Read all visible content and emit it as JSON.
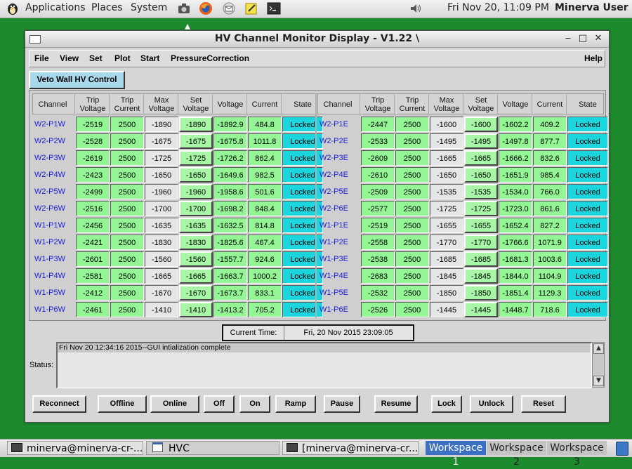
{
  "top_panel": {
    "applications": "Applications",
    "places": "Places",
    "system": "System",
    "clock": "Fri Nov 20, 11:09 PM",
    "user": "Minerva User"
  },
  "window": {
    "title": "HV Channel Monitor Display - V1.22 \\",
    "menus": [
      "File",
      "View",
      "Set",
      "Plot",
      "Start",
      "PressureCorrection"
    ],
    "help": "Help"
  },
  "tab_label": "Veto Wall HV Control",
  "headers": {
    "channel": "Channel",
    "trip_voltage": "Trip Voltage",
    "trip_current": "Trip Current",
    "max_voltage": "Max Voltage",
    "set_voltage": "Set Voltage",
    "voltage": "Voltage",
    "current": "Current",
    "state": "State"
  },
  "left_rows": [
    {
      "channel": "W2-P1W",
      "trip_voltage": "-2519",
      "trip_current": "2500",
      "max_voltage": "-1890",
      "set_voltage": "-1890",
      "voltage": "-1892.9",
      "current": "484.8",
      "state": "Locked"
    },
    {
      "channel": "W2-P2W",
      "trip_voltage": "-2528",
      "trip_current": "2500",
      "max_voltage": "-1675",
      "set_voltage": "-1675",
      "voltage": "-1675.8",
      "current": "1011.8",
      "state": "Locked"
    },
    {
      "channel": "W2-P3W",
      "trip_voltage": "-2619",
      "trip_current": "2500",
      "max_voltage": "-1725",
      "set_voltage": "-1725",
      "voltage": "-1726.2",
      "current": "862.4",
      "state": "Locked"
    },
    {
      "channel": "W2-P4W",
      "trip_voltage": "-2423",
      "trip_current": "2500",
      "max_voltage": "-1650",
      "set_voltage": "-1650",
      "voltage": "-1649.6",
      "current": "982.5",
      "state": "Locked"
    },
    {
      "channel": "W2-P5W",
      "trip_voltage": "-2499",
      "trip_current": "2500",
      "max_voltage": "-1960",
      "set_voltage": "-1960",
      "voltage": "-1958.6",
      "current": "501.6",
      "state": "Locked"
    },
    {
      "channel": "W2-P6W",
      "trip_voltage": "-2516",
      "trip_current": "2500",
      "max_voltage": "-1700",
      "set_voltage": "-1700",
      "voltage": "-1698.2",
      "current": "848.4",
      "state": "Locked"
    },
    {
      "channel": "W1-P1W",
      "trip_voltage": "-2456",
      "trip_current": "2500",
      "max_voltage": "-1635",
      "set_voltage": "-1635",
      "voltage": "-1632.5",
      "current": "814.8",
      "state": "Locked"
    },
    {
      "channel": "W1-P2W",
      "trip_voltage": "-2421",
      "trip_current": "2500",
      "max_voltage": "-1830",
      "set_voltage": "-1830",
      "voltage": "-1825.6",
      "current": "467.4",
      "state": "Locked"
    },
    {
      "channel": "W1-P3W",
      "trip_voltage": "-2601",
      "trip_current": "2500",
      "max_voltage": "-1560",
      "set_voltage": "-1560",
      "voltage": "-1557.7",
      "current": "924.6",
      "state": "Locked"
    },
    {
      "channel": "W1-P4W",
      "trip_voltage": "-2581",
      "trip_current": "2500",
      "max_voltage": "-1665",
      "set_voltage": "-1665",
      "voltage": "-1663.7",
      "current": "1000.2",
      "state": "Locked"
    },
    {
      "channel": "W1-P5W",
      "trip_voltage": "-2412",
      "trip_current": "2500",
      "max_voltage": "-1670",
      "set_voltage": "-1670",
      "voltage": "-1673.7",
      "current": "833.1",
      "state": "Locked"
    },
    {
      "channel": "W1-P6W",
      "trip_voltage": "-2461",
      "trip_current": "2500",
      "max_voltage": "-1410",
      "set_voltage": "-1410",
      "voltage": "-1413.2",
      "current": "705.2",
      "state": "Locked"
    }
  ],
  "right_rows": [
    {
      "channel": "W2-P1E",
      "trip_voltage": "-2447",
      "trip_current": "2500",
      "max_voltage": "-1600",
      "set_voltage": "-1600",
      "voltage": "-1602.2",
      "current": "409.2",
      "state": "Locked"
    },
    {
      "channel": "W2-P2E",
      "trip_voltage": "-2533",
      "trip_current": "2500",
      "max_voltage": "-1495",
      "set_voltage": "-1495",
      "voltage": "-1497.8",
      "current": "877.7",
      "state": "Locked"
    },
    {
      "channel": "W2-P3E",
      "trip_voltage": "-2609",
      "trip_current": "2500",
      "max_voltage": "-1665",
      "set_voltage": "-1665",
      "voltage": "-1666.2",
      "current": "832.6",
      "state": "Locked"
    },
    {
      "channel": "W2-P4E",
      "trip_voltage": "-2610",
      "trip_current": "2500",
      "max_voltage": "-1650",
      "set_voltage": "-1650",
      "voltage": "-1651.9",
      "current": "985.4",
      "state": "Locked"
    },
    {
      "channel": "W2-P5E",
      "trip_voltage": "-2509",
      "trip_current": "2500",
      "max_voltage": "-1535",
      "set_voltage": "-1535",
      "voltage": "-1534.0",
      "current": "766.0",
      "state": "Locked"
    },
    {
      "channel": "W2-P6E",
      "trip_voltage": "-2577",
      "trip_current": "2500",
      "max_voltage": "-1725",
      "set_voltage": "-1725",
      "voltage": "-1723.0",
      "current": "861.6",
      "state": "Locked"
    },
    {
      "channel": "W1-P1E",
      "trip_voltage": "-2519",
      "trip_current": "2500",
      "max_voltage": "-1655",
      "set_voltage": "-1655",
      "voltage": "-1652.4",
      "current": "827.2",
      "state": "Locked"
    },
    {
      "channel": "W1-P2E",
      "trip_voltage": "-2558",
      "trip_current": "2500",
      "max_voltage": "-1770",
      "set_voltage": "-1770",
      "voltage": "-1766.6",
      "current": "1071.9",
      "state": "Locked"
    },
    {
      "channel": "W1-P3E",
      "trip_voltage": "-2538",
      "trip_current": "2500",
      "max_voltage": "-1685",
      "set_voltage": "-1685",
      "voltage": "-1681.3",
      "current": "1003.6",
      "state": "Locked"
    },
    {
      "channel": "W1-P4E",
      "trip_voltage": "-2683",
      "trip_current": "2500",
      "max_voltage": "-1845",
      "set_voltage": "-1845",
      "voltage": "-1844.0",
      "current": "1104.9",
      "state": "Locked"
    },
    {
      "channel": "W1-P5E",
      "trip_voltage": "-2532",
      "trip_current": "2500",
      "max_voltage": "-1850",
      "set_voltage": "-1850",
      "voltage": "-1851.4",
      "current": "1129.3",
      "state": "Locked"
    },
    {
      "channel": "W1-P6E",
      "trip_voltage": "-2526",
      "trip_current": "2500",
      "max_voltage": "-1445",
      "set_voltage": "-1445",
      "voltage": "-1448.7",
      "current": "718.6",
      "state": "Locked"
    }
  ],
  "current_time": {
    "label": "Current Time:",
    "value": "Fri, 20 Nov 2015 23:09:05"
  },
  "status": {
    "label": "Status:",
    "message": "Fri Nov 20 12:34:16 2015--GUI intialization complete"
  },
  "actions": [
    "Reconnect",
    "Offline",
    "Online",
    "Off",
    "On",
    "Ramp",
    "Pause",
    "Resume",
    "Lock",
    "Unlock",
    "Reset"
  ],
  "taskbar": {
    "tasks": [
      "minerva@minerva-cr-...",
      "HVC",
      "[minerva@minerva-cr..."
    ],
    "workspaces": [
      "Workspace 1",
      "Workspace 2",
      "Workspace 3"
    ]
  },
  "colors": {
    "locked": "#1ad6de",
    "readback": "#93f593",
    "channel_text": "#1a1ad8",
    "desktop": "#1e8a2e"
  }
}
